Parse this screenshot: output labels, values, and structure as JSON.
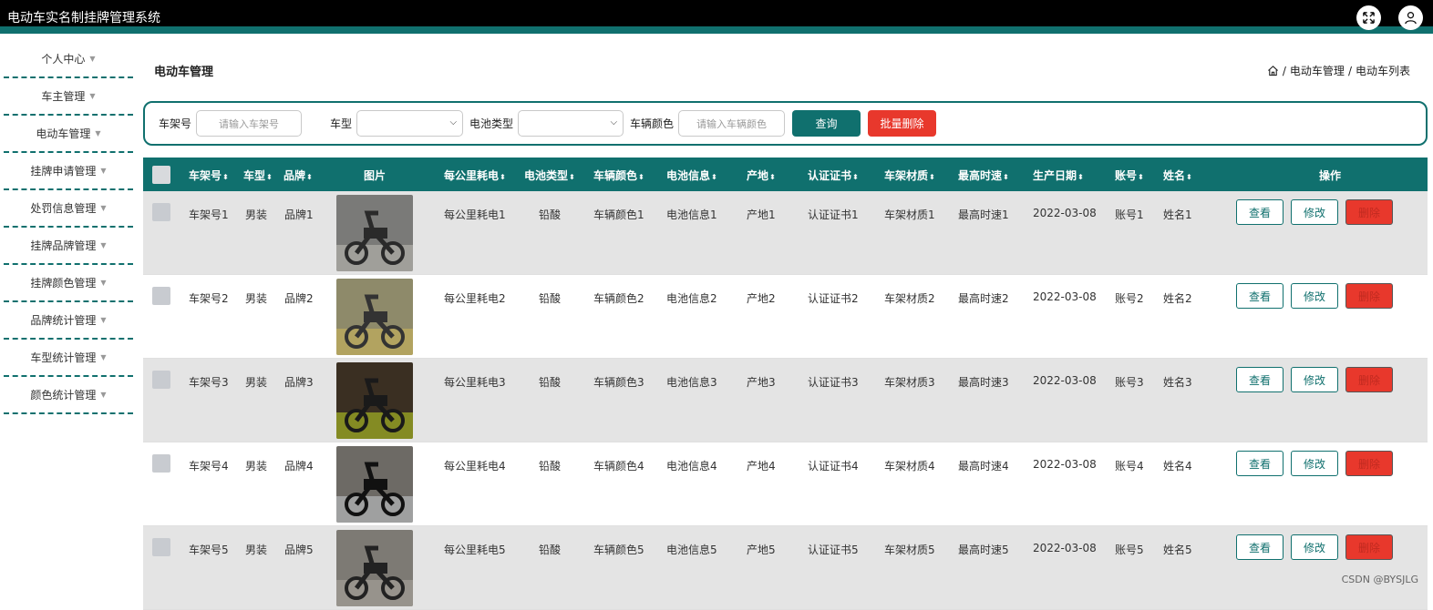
{
  "app": {
    "title": "电动车实名制挂牌管理系统"
  },
  "header": {
    "fullscreen_icon": "fullscreen-icon",
    "user_icon": "user-icon"
  },
  "sidebar": {
    "items": [
      {
        "label": "个人中心"
      },
      {
        "label": "车主管理"
      },
      {
        "label": "电动车管理"
      },
      {
        "label": "挂牌申请管理"
      },
      {
        "label": "处罚信息管理"
      },
      {
        "label": "挂牌品牌管理"
      },
      {
        "label": "挂牌颜色管理"
      },
      {
        "label": "品牌统计管理"
      },
      {
        "label": "车型统计管理"
      },
      {
        "label": "颜色统计管理"
      }
    ]
  },
  "page": {
    "title": "电动车管理",
    "breadcrumb": {
      "home_icon": "home-icon",
      "sep": "/",
      "level1": "电动车管理",
      "level2": "电动车列表"
    }
  },
  "search": {
    "frame_label": "车架号",
    "frame_placeholder": "请输入车架号",
    "model_label": "车型",
    "model_value": "",
    "battery_label": "电池类型",
    "battery_value": "",
    "color_label": "车辆颜色",
    "color_placeholder": "请输入车辆颜色",
    "query_button": "查询",
    "batch_delete_button": "批量删除"
  },
  "table": {
    "columns": [
      "车架号",
      "车型",
      "品牌",
      "图片",
      "每公里耗电",
      "电池类型",
      "车辆颜色",
      "电池信息",
      "产地",
      "认证证书",
      "车架材质",
      "最高时速",
      "生产日期",
      "账号",
      "姓名",
      "操作"
    ],
    "rows": [
      {
        "frame": "车架号1",
        "model": "男装",
        "brand": "品牌1",
        "power": "每公里耗电1",
        "battery": "铅酸",
        "color": "车辆颜色1",
        "battery_info": "电池信息1",
        "origin": "产地1",
        "cert": "认证证书1",
        "material": "车架材质1",
        "speed": "最高时速1",
        "date": "2022-03-08",
        "account": "账号1",
        "name": "姓名1"
      },
      {
        "frame": "车架号2",
        "model": "男装",
        "brand": "品牌2",
        "power": "每公里耗电2",
        "battery": "铅酸",
        "color": "车辆颜色2",
        "battery_info": "电池信息2",
        "origin": "产地2",
        "cert": "认证证书2",
        "material": "车架材质2",
        "speed": "最高时速2",
        "date": "2022-03-08",
        "account": "账号2",
        "name": "姓名2"
      },
      {
        "frame": "车架号3",
        "model": "男装",
        "brand": "品牌3",
        "power": "每公里耗电3",
        "battery": "铅酸",
        "color": "车辆颜色3",
        "battery_info": "电池信息3",
        "origin": "产地3",
        "cert": "认证证书3",
        "material": "车架材质3",
        "speed": "最高时速3",
        "date": "2022-03-08",
        "account": "账号3",
        "name": "姓名3"
      },
      {
        "frame": "车架号4",
        "model": "男装",
        "brand": "品牌4",
        "power": "每公里耗电4",
        "battery": "铅酸",
        "color": "车辆颜色4",
        "battery_info": "电池信息4",
        "origin": "产地4",
        "cert": "认证证书4",
        "material": "车架材质4",
        "speed": "最高时速4",
        "date": "2022-03-08",
        "account": "账号4",
        "name": "姓名4"
      },
      {
        "frame": "车架号5",
        "model": "男装",
        "brand": "品牌5",
        "power": "每公里耗电5",
        "battery": "铅酸",
        "color": "车辆颜色5",
        "battery_info": "电池信息5",
        "origin": "产地5",
        "cert": "认证证书5",
        "material": "车架材质5",
        "speed": "最高时速5",
        "date": "2022-03-08",
        "account": "账号5",
        "name": "姓名5"
      }
    ],
    "actions": {
      "view": "查看",
      "edit": "修改",
      "delete": "删除"
    }
  },
  "watermark": "CSDN @BYSJLG",
  "colors": {
    "accent": "#10706e",
    "danger": "#e8382c",
    "header_bg": "#000000",
    "row_alt": "#e4e4e4"
  }
}
